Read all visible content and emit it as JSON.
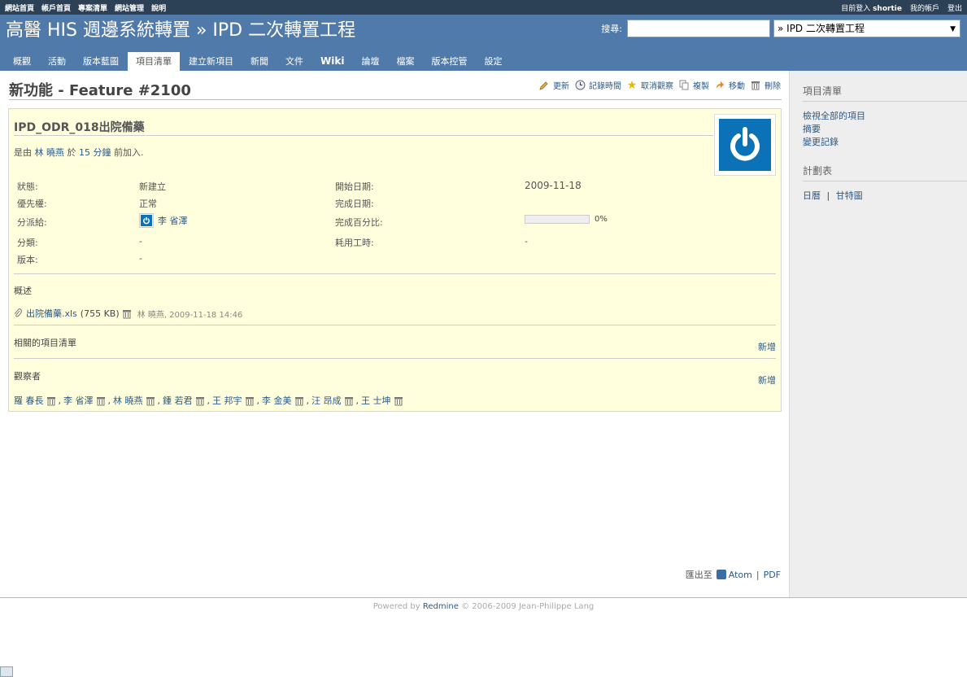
{
  "top_menu": {
    "left": [
      "網站首頁",
      "帳戶首頁",
      "專案清單",
      "網站管理",
      "說明"
    ],
    "logged_in_prefix": "目前登入",
    "username": "shortie",
    "my_account": "我的帳戶",
    "logout": "登出"
  },
  "header": {
    "title": "高醫 HIS 週邊系統轉置 » IPD 二次轉置工程",
    "search_label": "搜尋:",
    "search_value": "",
    "jump_value": "» IPD 二次轉置工程"
  },
  "main_menu": [
    "概觀",
    "活動",
    "版本藍圖",
    "項目清單",
    "建立新項目",
    "新聞",
    "文件",
    "Wiki",
    "論壇",
    "檔案",
    "版本控管",
    "設定"
  ],
  "issue": {
    "heading": "新功能 - Feature #2100",
    "actions": [
      "更新",
      "記錄時間",
      "取消觀察",
      "複製",
      "移動",
      "刪除"
    ],
    "subject": "IPD_ODR_018出院備藥",
    "author_prefix": "是由",
    "author": "林 曉燕",
    "author_mid": "於",
    "age": "15 分鐘",
    "author_suffix": "前加入.",
    "status_label": "狀態:",
    "status": "新建立",
    "priority_label": "優先權:",
    "priority": "正常",
    "assigned_label": "分派給:",
    "assigned": "李 省澤",
    "category_label": "分類:",
    "category": "-",
    "version_label": "版本:",
    "version": "-",
    "start_label": "開始日期:",
    "start": "2009-11-18",
    "due_label": "完成日期:",
    "due": "",
    "done_label": "完成百分比:",
    "done": "0%",
    "done_value": 0,
    "spent_label": "耗用工時:",
    "spent": "-",
    "description_label": "概述",
    "attachment": {
      "name": "出院備藥.xls",
      "size": "(755 KB)",
      "meta": "林 曉燕, 2009-11-18 14:46"
    },
    "relations_label": "相關的項目清單",
    "relations_add": "新增",
    "watchers_label": "觀察者",
    "watchers_add": "新增",
    "watchers": [
      "羅 春長",
      "李 省澤",
      "林 曉燕",
      "鍾 若君",
      "王 邦宇",
      "李 金美",
      "汪 昂成",
      "王 士坤"
    ]
  },
  "export": {
    "label": "匯出至",
    "atom": "Atom",
    "pdf": "PDF"
  },
  "sidebar": {
    "issues_title": "項目清單",
    "issues_links": [
      "檢視全部的項目",
      "摘要",
      "變更記錄"
    ],
    "planning_title": "計劃表",
    "calendar": "日曆",
    "gantt": "甘特圖"
  },
  "footer": {
    "prefix": "Powered by",
    "link": "Redmine",
    "suffix": "© 2006-2009 Jean-Philippe Lang"
  },
  "colors": {
    "header": "#507aaa",
    "top_menu": "#2c4056",
    "issue_bg": "#ffffdd",
    "link": "#2a5a8a"
  }
}
